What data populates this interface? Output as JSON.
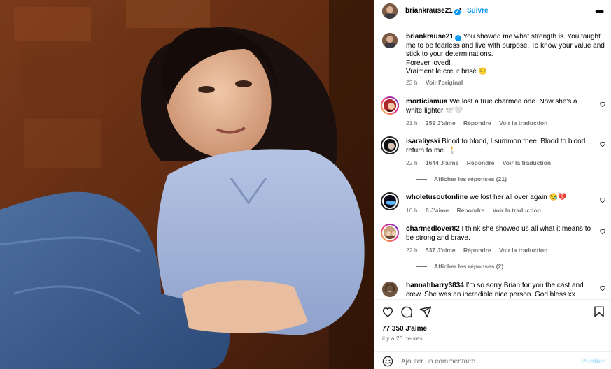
{
  "post": {
    "username": "briankrause21",
    "follow_label": "Suivre",
    "more_label": "•••",
    "separator": "•"
  },
  "caption": {
    "username": "briankrause21",
    "text_1": "You showed me what strength is. You taught me to be fearless and live with purpose. To know your value and stick to your determinations.",
    "text_2": "Forever loved!",
    "text_3": "Vraiment le cœur brisé 😔",
    "time": "23 h",
    "see_original": "Voir l'original"
  },
  "comments": [
    {
      "username": "morticiamua",
      "text": "We lost a true charmed one. Now she's a white lighter 🕊️🤍",
      "time": "21 h",
      "likes": "259 J'aime",
      "reply": "Répondre",
      "translate": "Voir la traduction"
    },
    {
      "username": "isaraliyski",
      "text": "Blood to blood, I summon thee. Blood to blood return to me. 🕯️",
      "time": "22 h",
      "likes": "1644 J'aime",
      "reply": "Répondre",
      "translate": "Voir la traduction",
      "replies": "Afficher les réponses (21)"
    },
    {
      "username": "wholetusoutonline",
      "text": "we lost her all over again 😪💔",
      "time": "10 h",
      "likes": "8 J'aime",
      "reply": "Répondre",
      "translate": "Voir la traduction"
    },
    {
      "username": "charmedlover82",
      "text": "I think she showed us all what it means to be strong and brave.",
      "time": "22 h",
      "likes": "537 J'aime",
      "reply": "Répondre",
      "translate": "Voir la traduction",
      "replies": "Afficher les réponses (2)"
    },
    {
      "username": "hannahbarry3834",
      "text": "I'm so sorry Brian for you the cast and crew. She was an incredible nice person. God bless xx"
    }
  ],
  "footer": {
    "likes_count": "77 350 J'aime",
    "time_ago": "il y a 23 heures",
    "comment_placeholder": "Ajouter un commentaire...",
    "publish_label": "Publier"
  },
  "icons": {
    "verified": "verified-badge-icon",
    "like": "heart-outline-icon",
    "comment": "speech-bubble-icon",
    "share": "paper-plane-icon",
    "save": "bookmark-icon",
    "emoji": "smiley-icon"
  },
  "colors": {
    "accent": "#0095f6",
    "muted_text": "#737373",
    "publish_disabled": "#b2dffc"
  }
}
